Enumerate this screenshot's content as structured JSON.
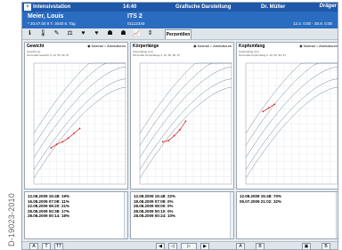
{
  "side_label": "D-19023-2010",
  "titlebar": {
    "station": "Intensivstation",
    "time": "14:40",
    "view": "Grafische Darstellung",
    "user": "Dr. Müller",
    "brand": "Dräger"
  },
  "patient": {
    "name": "Meier, Louis",
    "details": "* 20.07.00  8 T. 3040  6. Tag",
    "bed": "ITS 2",
    "bed_id": "01112340",
    "range": "12.4. 0:00 - 30.8. 0:00"
  },
  "toolbar": {
    "icons": [
      "info-icon",
      "thermometer-icon",
      "syringe-icon",
      "balance-icon",
      "heart-icon",
      "heart-outline-icon",
      "lungs-icon",
      "lungs-outline-icon",
      "growth-icon",
      "ruler-icon"
    ],
    "glyphs": [
      "ℹ",
      "🌡",
      "✎",
      "⚖",
      "♥",
      "♥",
      "☗",
      "☗",
      "📈",
      "⇕"
    ],
    "active_tab": "Perzentilen"
  },
  "panels": [
    {
      "title": "Gewicht",
      "radio_normal": "Normal",
      "radio_amnio": "Amnioticum",
      "legend": [
        "Gewicht (g)",
        "Perzentile Gewicht 3, 10, 50, 90, 97"
      ],
      "history": [
        "12.08.2009 15:48: 19%",
        "16.08.2009 07:08: 11%",
        "22.08.2009 08:20: 21%",
        "28.08.2009 00:38: 17%",
        "28.08.2009 00:14: 18%"
      ]
    },
    {
      "title": "Körperlänge",
      "radio_normal": "Normal",
      "radio_amnio": "Amnioticum",
      "legend": [
        "Körperlänge (cm)",
        "Perzentile Körperlänge 3, 10, 50, 90, 97"
      ],
      "history": [
        "12.08.2009 15:48: 22%",
        "18.08.2009 07:08: 0%",
        "28.08.2009 08:00: 0%",
        "28.08.2009 00:10: 0%",
        "28.08.2009 00:24: 10%"
      ]
    },
    {
      "title": "Kopfumfang",
      "radio_normal": "Normal",
      "radio_amnio": "Amnioticum",
      "legend": [
        "Kopfumfang (cm)",
        "Perzentile Kopfumfang 3, 10, 50, 90, 97"
      ],
      "history": [
        "12.08.2009 15:48: 70%",
        "06.07.2009 21:02: 32%"
      ]
    }
  ],
  "chart_data": [
    {
      "type": "line",
      "title": "Gewicht",
      "patient_series": [
        [
          3,
          0.3
        ],
        [
          4,
          0.33
        ],
        [
          5,
          0.35
        ],
        [
          6,
          0.38
        ],
        [
          7,
          0.42
        ],
        [
          8,
          0.46
        ]
      ]
    },
    {
      "type": "line",
      "title": "Körperlänge",
      "patient_series": [
        [
          4,
          0.35
        ],
        [
          5,
          0.36
        ],
        [
          6,
          0.4
        ],
        [
          7,
          0.45
        ],
        [
          8,
          0.52
        ]
      ]
    },
    {
      "type": "line",
      "title": "Kopfumfang",
      "patient_series": [
        [
          3,
          0.6
        ],
        [
          4,
          0.63
        ],
        [
          5,
          0.66
        ]
      ]
    }
  ],
  "footer": {
    "buttons": [
      "A",
      "T",
      "TT",
      "◀",
      "◁",
      "▷",
      "▶",
      "A",
      "B",
      "▣",
      "B"
    ]
  }
}
